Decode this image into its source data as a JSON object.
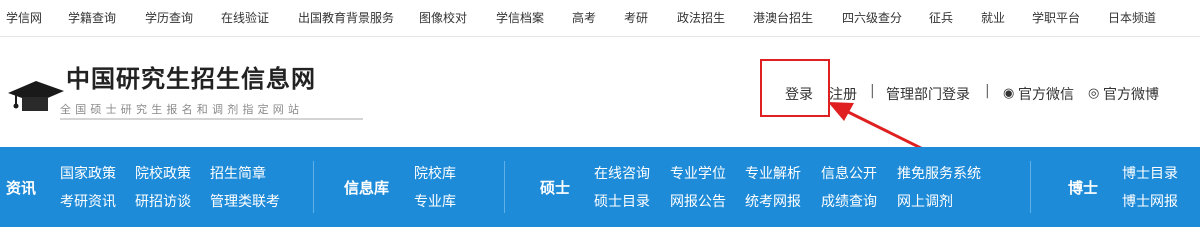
{
  "topbar": {
    "links": [
      "学信网",
      "学籍查询",
      "学历查询",
      "在线验证",
      "出国教育背景服务",
      "图像校对",
      "学信档案",
      "高考",
      "考研",
      "政法招生",
      "港澳台招生",
      "四六级查分",
      "征兵",
      "就业",
      "学职平台",
      "日本频道"
    ]
  },
  "header": {
    "site_title": "中国研究生招生信息网",
    "site_subtitle": "全国硕士研究生报名和调剂指定网站",
    "login": "登录",
    "register": "注册",
    "sep": "|",
    "admin_login": "管理部门登录",
    "wechat": "官方微信",
    "weibo": "官方微博",
    "colors": {
      "highlight": "#e02020",
      "arrow": "#e02020"
    }
  },
  "nav": {
    "background": "#1e8bd9",
    "categories": [
      {
        "title": "资讯",
        "links": [
          "国家政策",
          "院校政策",
          "招生简章",
          "考研资讯",
          "研招访谈",
          "管理类联考"
        ]
      },
      {
        "title": "信息库",
        "links": [
          "院校库",
          "专业库"
        ]
      },
      {
        "title": "硕士",
        "links": [
          "在线咨询",
          "专业学位",
          "专业解析",
          "信息公开",
          "推免服务系统",
          "硕士目录",
          "网报公告",
          "统考网报",
          "成绩查询",
          "网上调剂"
        ]
      },
      {
        "title": "博士",
        "links": [
          "博士目录",
          "博士网报"
        ]
      }
    ]
  }
}
